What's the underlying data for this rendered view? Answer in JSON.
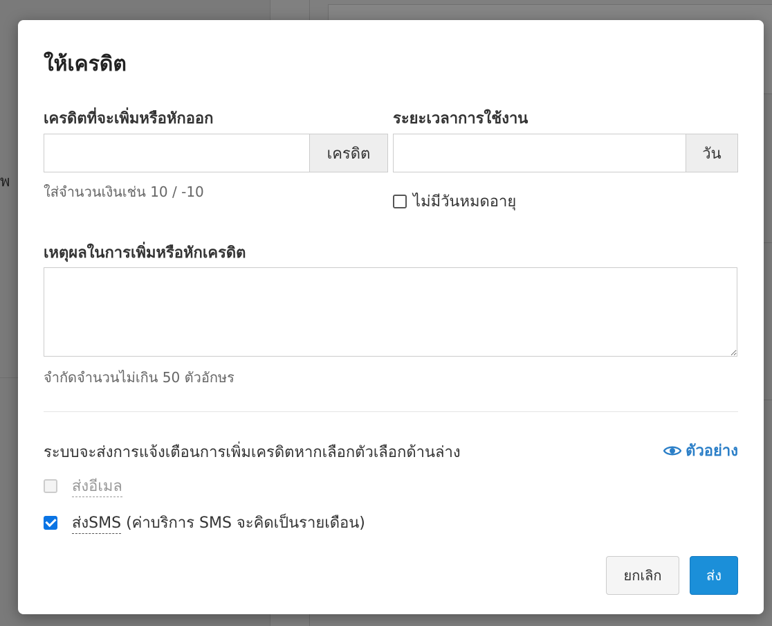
{
  "modal": {
    "title": "ให้เครดิต",
    "credit_label": "เครดิตที่จะเพิ่มหรือหักออก",
    "credit_value": "",
    "credit_addon": "เครดิต",
    "credit_help": "ใส่จำนวนเงินเช่น 10 / -10",
    "duration_label": "ระยะเวลาการใช้งาน",
    "duration_value": "",
    "duration_addon": "วัน",
    "no_expiry_label": "ไม่มีวันหมดอายุ",
    "no_expiry_checked": false,
    "reason_label": "เหตุผลในการเพิ่มหรือหักเครดิต",
    "reason_value": "",
    "reason_help": "จำกัดจำนวนไม่เกิน 50 ตัวอักษร",
    "notify_text": "ระบบจะส่งการแจ้งเตือนการเพิ่มเครดิตหากเลือกตัวเลือกด้านล่าง",
    "preview_label": "ตัวอย่าง",
    "options": [
      {
        "label": "ส่งอีเมล",
        "suffix": "",
        "checked": false,
        "disabled": true
      },
      {
        "label": "ส่งSMS",
        "suffix": " (ค่าบริการ SMS จะคิดเป็นรายเดือน)",
        "checked": true,
        "disabled": false
      }
    ],
    "cancel_label": "ยกเลิก",
    "send_label": "ส่ง"
  },
  "background": {
    "edge_text": "ัพ"
  },
  "colors": {
    "link": "#2a7ec7",
    "primary": "#1b8fd9",
    "checkbox_checked": "#0a74e4"
  },
  "icons": {
    "preview": "eye-icon"
  }
}
